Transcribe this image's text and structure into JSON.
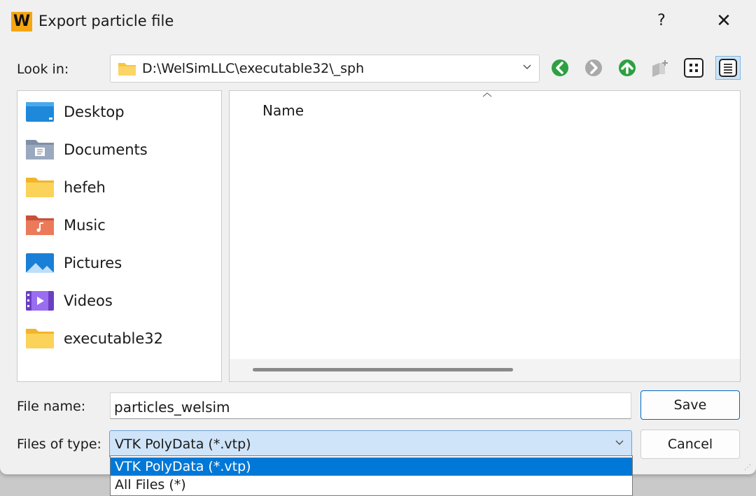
{
  "window": {
    "app_icon_letter": "W",
    "title": "Export particle file",
    "help": "?",
    "close": "✕"
  },
  "lookin": {
    "label": "Look in:",
    "path": "D:\\WelSimLLC\\executable32\\_sph"
  },
  "toolbar": {
    "back_icon": "back-arrow-icon",
    "forward_icon": "forward-arrow-icon",
    "up_icon": "up-arrow-icon",
    "new_folder_icon": "new-folder-icon",
    "list_view_icon": "list-view-icon",
    "detail_view_icon": "detail-view-icon"
  },
  "sidebar": {
    "items": [
      {
        "label": "Desktop",
        "icon": "desktop-folder-icon"
      },
      {
        "label": "Documents",
        "icon": "documents-folder-icon"
      },
      {
        "label": "hefeh",
        "icon": "folder-icon"
      },
      {
        "label": "Music",
        "icon": "music-folder-icon"
      },
      {
        "label": "Pictures",
        "icon": "pictures-folder-icon"
      },
      {
        "label": "Videos",
        "icon": "videos-folder-icon"
      },
      {
        "label": "executable32",
        "icon": "folder-icon"
      }
    ]
  },
  "filelist": {
    "column_name": "Name",
    "sort_indicator": "^"
  },
  "filename": {
    "label": "File name:",
    "value": "particles_welsim"
  },
  "filetype": {
    "label": "Files of type:",
    "selected": "VTK PolyData (*.vtp)",
    "options": [
      "VTK PolyData (*.vtp)",
      "All Files (*)"
    ]
  },
  "buttons": {
    "save": "Save",
    "cancel": "Cancel"
  },
  "colors": {
    "accent": "#0078d7",
    "folder": "#f8c63d",
    "nav_green": "#2ea043",
    "app_icon": "#f5a613"
  }
}
